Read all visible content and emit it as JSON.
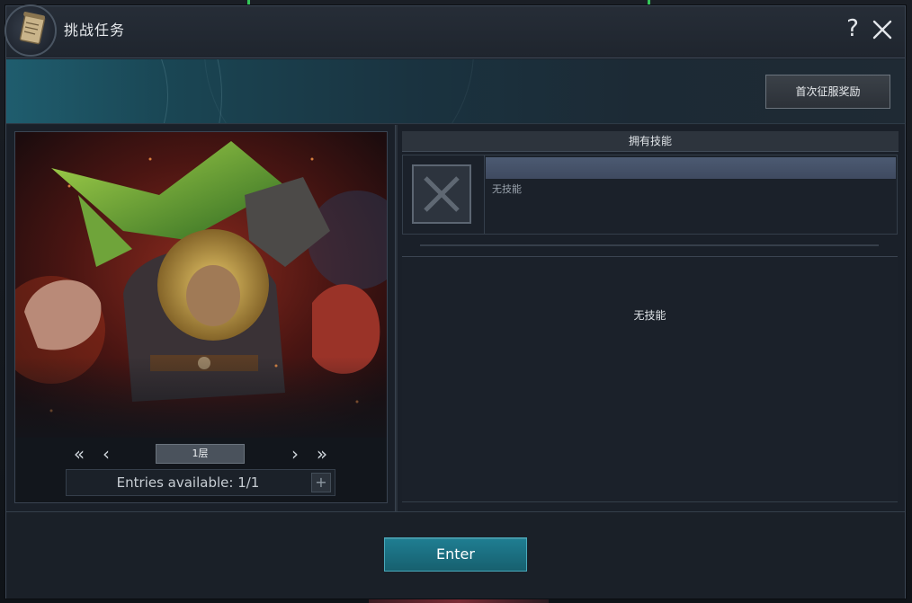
{
  "window": {
    "title": "挑战任务",
    "help_label": "?",
    "first_clear_reward_label": "首次征服奖励"
  },
  "floor_nav": {
    "first_label": "«",
    "prev_label": "‹",
    "floor_value": "1层",
    "next_label": "›",
    "last_label": "»"
  },
  "entries": {
    "text": "Entries available: 1/1",
    "add_label": "+"
  },
  "skills": {
    "header": "拥有技能",
    "slot_description": "无技能",
    "detail_text": "无技能"
  },
  "footer": {
    "enter_label": "Enter"
  },
  "colors": {
    "accent_teal": "#1f7e92",
    "skill_bar": "#4c5a72",
    "panel_bg": "#1c222b"
  },
  "icons": {
    "title_emblem": "scroll-icon",
    "close": "close-icon",
    "empty_skill": "empty-slot-x-icon",
    "add": "plus-icon"
  }
}
